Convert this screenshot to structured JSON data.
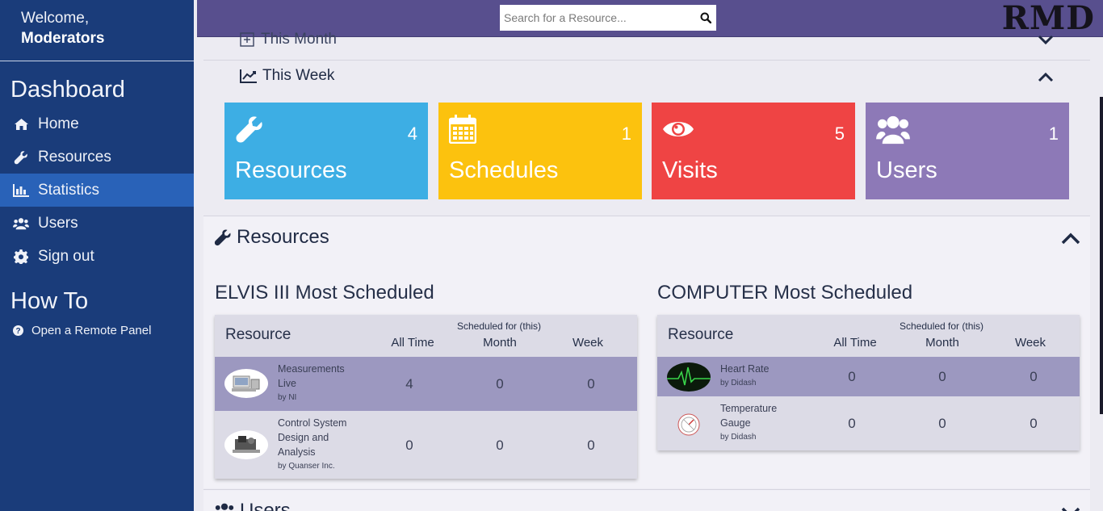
{
  "sidebar": {
    "welcome": "Welcome,",
    "user": "Moderators",
    "dashboard_title": "Dashboard",
    "nav": [
      {
        "label": "Home",
        "icon": "home-icon"
      },
      {
        "label": "Resources",
        "icon": "wrench-icon"
      },
      {
        "label": "Statistics",
        "icon": "bar-chart-icon",
        "active": true
      },
      {
        "label": "Users",
        "icon": "users-icon"
      },
      {
        "label": "Sign out",
        "icon": "gear-icon"
      }
    ],
    "howto_title": "How To",
    "howto_items": [
      {
        "label": "Open a Remote Panel",
        "icon": "question-circle-icon"
      }
    ]
  },
  "topbar": {
    "search_placeholder": "Search for a Resource...",
    "brand": "RMD"
  },
  "stats": {
    "month_label": "This Month",
    "week_label": "This Week",
    "tiles": [
      {
        "label": "Resources",
        "count": "4",
        "icon": "wrench-icon",
        "color": "#3daee4"
      },
      {
        "label": "Schedules",
        "count": "1",
        "icon": "calendar-icon",
        "color": "#fcc20e"
      },
      {
        "label": "Visits",
        "count": "5",
        "icon": "eye-icon",
        "color": "#ef4444"
      },
      {
        "label": "Users",
        "count": "1",
        "icon": "users-icon",
        "color": "#8d79b7"
      }
    ]
  },
  "resources": {
    "title": "Resources",
    "tables": [
      {
        "title": "ELVIS III Most Scheduled",
        "header_resource": "Resource",
        "header_scheduled_for": "Scheduled for (this)",
        "cols": [
          "All Time",
          "Month",
          "Week"
        ],
        "rows": [
          {
            "name": "Measurements Live",
            "by": "by NI",
            "all_time": "4",
            "month": "0",
            "week": "0",
            "highlighted": true
          },
          {
            "name": "Control System Design and Analysis",
            "by": "by Quanser Inc.",
            "all_time": "0",
            "month": "0",
            "week": "0"
          }
        ]
      },
      {
        "title": "COMPUTER Most Scheduled",
        "header_resource": "Resource",
        "header_scheduled_for": "Scheduled for (this)",
        "cols": [
          "All Time",
          "Month",
          "Week"
        ],
        "rows": [
          {
            "name": "Heart Rate",
            "by": "by Didash",
            "all_time": "0",
            "month": "0",
            "week": "0",
            "highlighted": true
          },
          {
            "name": "Temperature Gauge",
            "by": "by Didash",
            "all_time": "0",
            "month": "0",
            "week": "0"
          }
        ]
      }
    ]
  },
  "users_section": {
    "title": "Users"
  }
}
